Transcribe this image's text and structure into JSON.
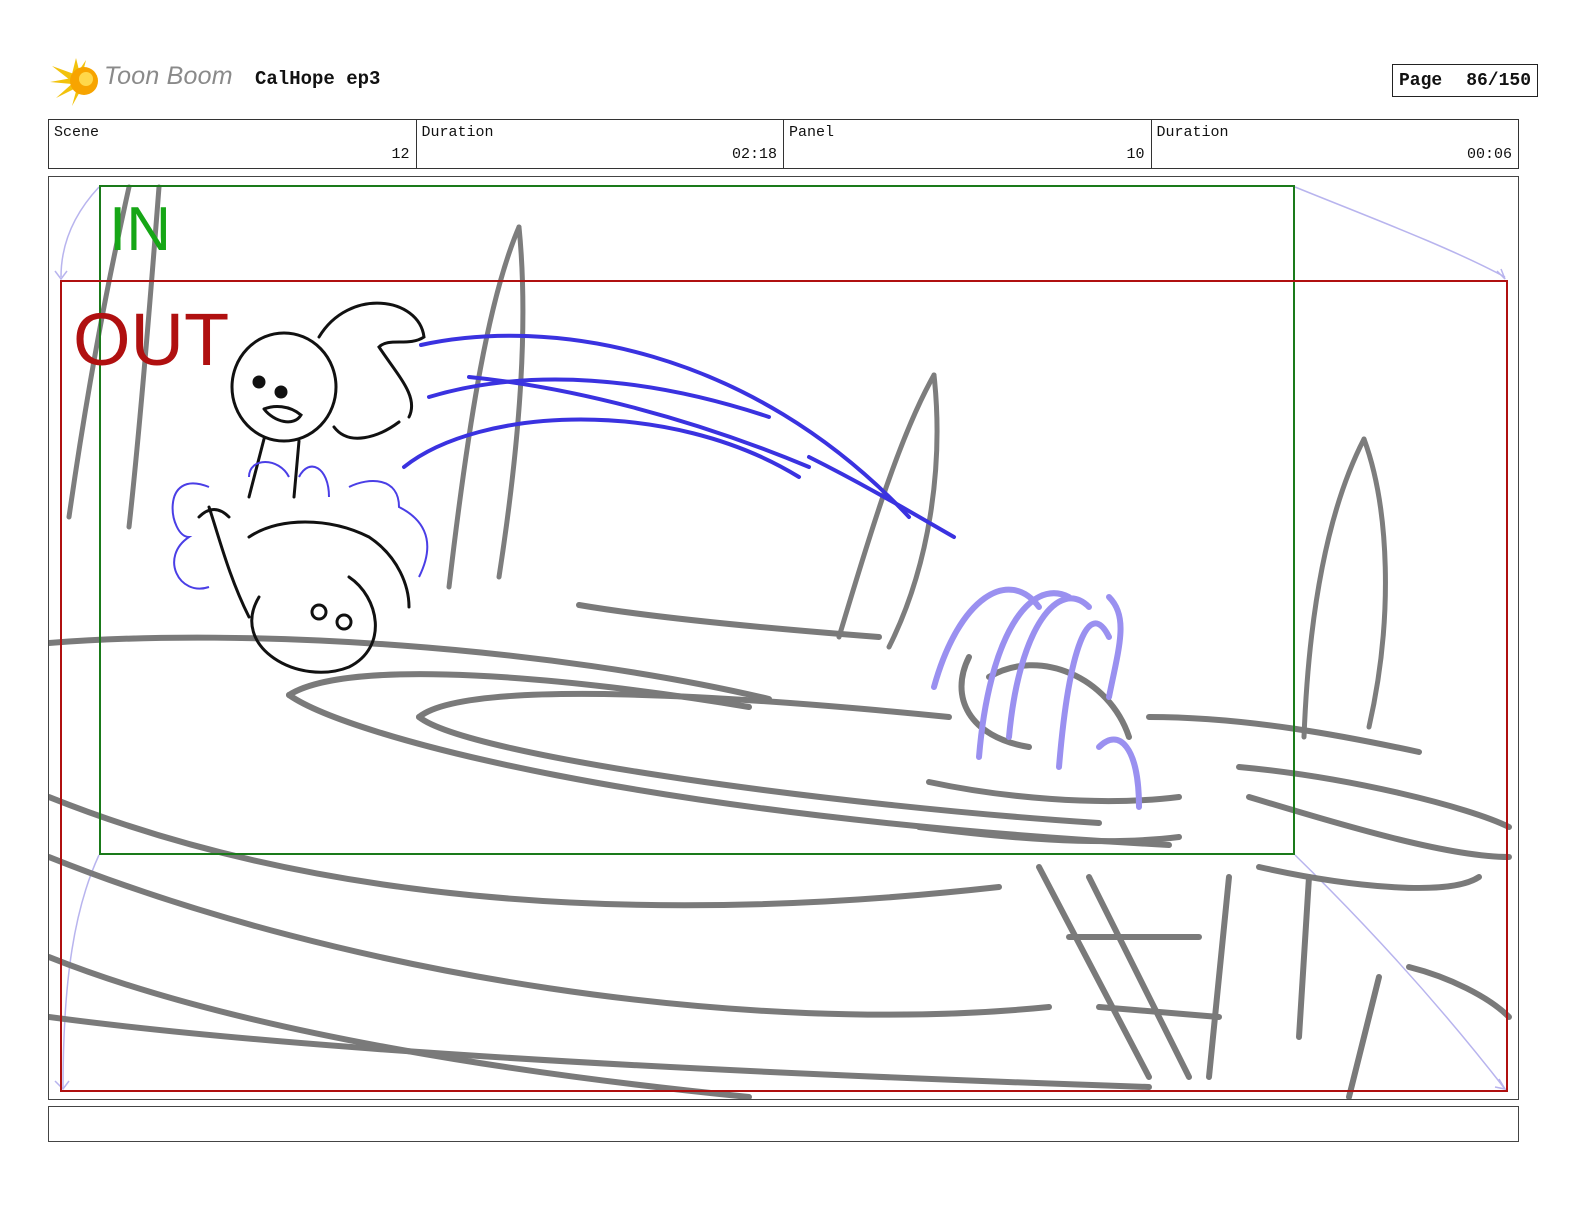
{
  "header": {
    "logo_text": "Toon Boom",
    "project_title": "CalHope ep3",
    "page_label": "Page",
    "page_value": "86/150"
  },
  "info": {
    "scene_label": "Scene",
    "scene_value": "12",
    "scene_duration_label": "Duration",
    "scene_duration_value": "02:18",
    "panel_label": "Panel",
    "panel_value": "10",
    "panel_duration_label": "Duration",
    "panel_duration_value": "00:06"
  },
  "panel": {
    "in_label": "IN",
    "out_label": "OUT"
  },
  "colors": {
    "in_frame": "#1a7a1a",
    "out_frame": "#b01010",
    "water": "#3a32e0",
    "fountain": "#9a90f0",
    "sketch": "#808080"
  }
}
